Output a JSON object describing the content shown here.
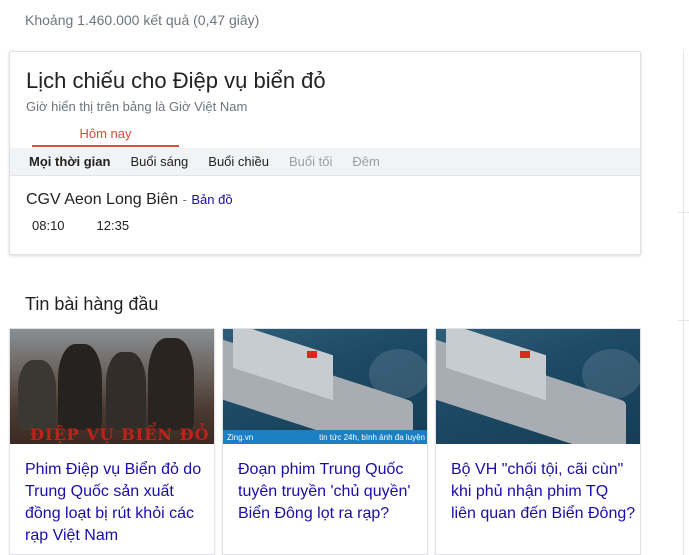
{
  "result_stats": "Khoảng 1.460.000 kết quả (0,47 giây)",
  "showtimes_card": {
    "title": "Lịch chiếu cho Điệp vụ biển đỏ",
    "subtitle": "Giờ hiển thị trên bảng là Giờ Việt Nam",
    "day_tab": "Hôm nay",
    "filters": [
      {
        "label": "Mọi thời gian"
      },
      {
        "label": "Buổi sáng"
      },
      {
        "label": "Buổi chiều"
      },
      {
        "label": "Buổi tối"
      },
      {
        "label": "Đêm"
      }
    ],
    "theater": {
      "name": "CGV Aeon Long Biên",
      "separator": "-",
      "map_link": "Bản đồ",
      "times": [
        "08:10",
        "12:35"
      ]
    }
  },
  "top_stories": {
    "title": "Tin bài hàng đầu",
    "items": [
      {
        "headline": "Phim Điệp vụ Biển đỏ do Trung Quốc sản xuất đồng loạt bị rút khỏi các rạp Việt Nam",
        "thumb": "movie-poster-image",
        "thumb_text": "ĐIỆP VỤ BIỂN ĐỎ"
      },
      {
        "headline": "Đoạn phim Trung Quốc tuyên truyền 'chủ quyền' Biển Đông lọt ra rạp?",
        "thumb": "warship-image",
        "thumb_brand": "Zing.vn",
        "thumb_caption": "tin tức 24h, bình ảnh đa luyện"
      },
      {
        "headline": "Bộ VH \"chối tội, cãi cùn\" khi phủ nhận phim TQ liên quan đến Biển Đông?",
        "thumb": "warship-image"
      }
    ]
  },
  "colors": {
    "link": "#1a0dab",
    "accent_red": "#dd4b39",
    "muted": "#70757a",
    "filter_bar": "#f1f3f4"
  }
}
